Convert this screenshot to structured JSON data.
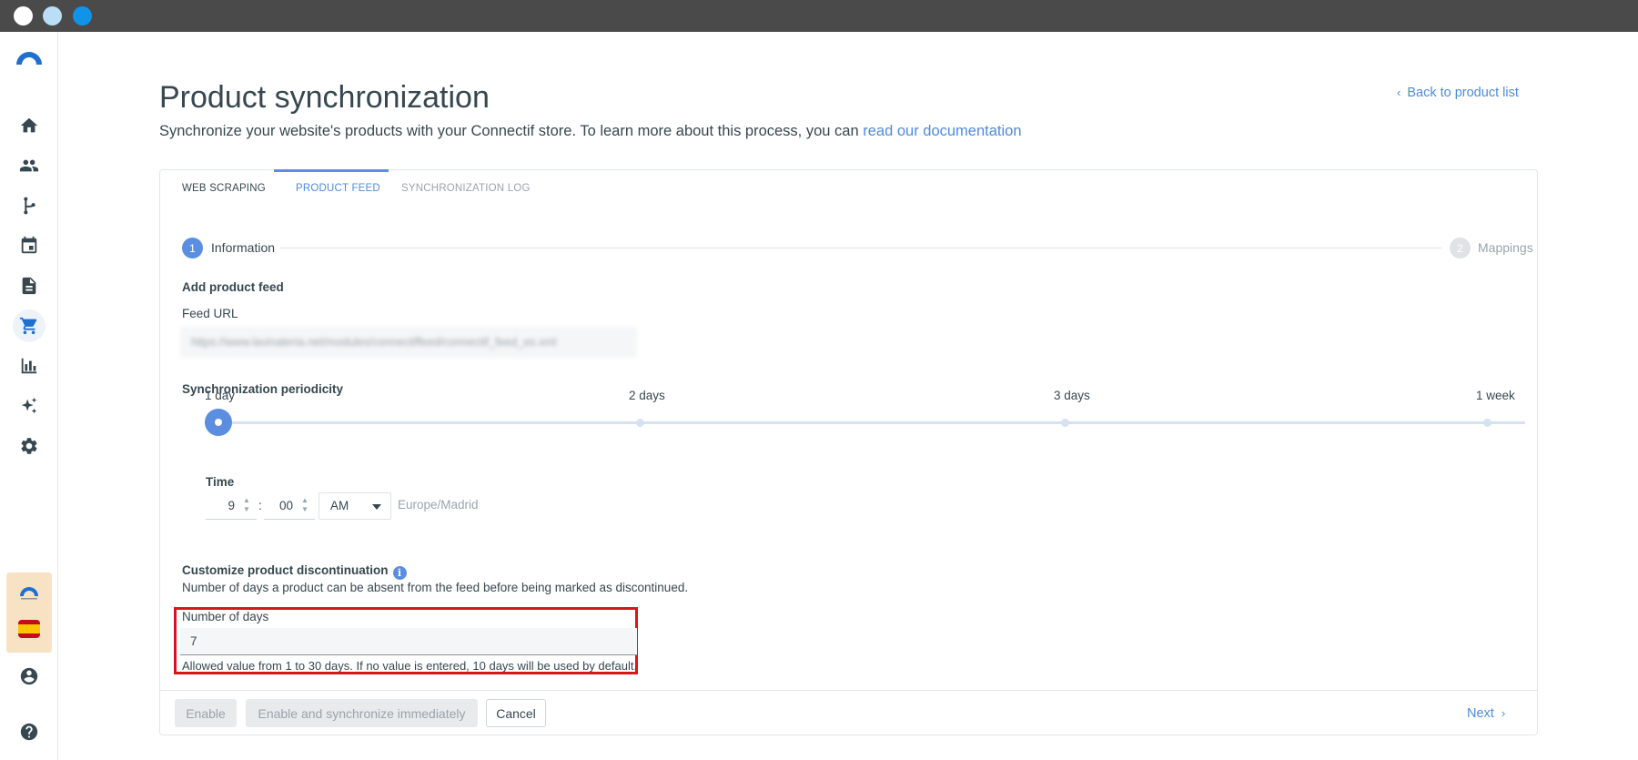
{
  "window": {
    "controls": [
      "close",
      "minimize",
      "maximize"
    ]
  },
  "sidebar": {
    "items": [
      {
        "icon": "home-icon"
      },
      {
        "icon": "contacts-icon"
      },
      {
        "icon": "workflow-icon"
      },
      {
        "icon": "calendar-icon"
      },
      {
        "icon": "document-icon"
      },
      {
        "icon": "cart-icon",
        "active": true
      },
      {
        "icon": "chart-icon"
      },
      {
        "icon": "sparkle-icon"
      },
      {
        "icon": "gear-icon"
      },
      {
        "icon": "user-icon"
      },
      {
        "icon": "help-icon"
      }
    ]
  },
  "header": {
    "title": "Product synchronization",
    "subtitle": "Synchronize your website's products with your Connectif store. To learn more about this process, you can ",
    "subtitle_link": "read our documentation",
    "back_link": "Back to product list"
  },
  "tabs": [
    {
      "label": "WEB SCRAPING"
    },
    {
      "label": "PRODUCT FEED",
      "active": true
    },
    {
      "label": "SYNCHRONIZATION LOG"
    }
  ],
  "stepper": {
    "steps": [
      {
        "number": "1",
        "label": "Information",
        "active": true
      },
      {
        "number": "2",
        "label": "Mappings",
        "active": false
      }
    ]
  },
  "form": {
    "add_feed_title": "Add product feed",
    "feed_url_label": "Feed URL",
    "feed_url_value": "https://www.lavinateria.net/modules/connectiffeed/connectif_feed_es.xml",
    "periodicity_title": "Synchronization periodicity",
    "periodicity_options": [
      "1 day",
      "2 days",
      "3 days",
      "1 week"
    ],
    "periodicity_selected": "1 day",
    "time_label": "Time",
    "time_hour": "9",
    "time_minute": "00",
    "time_separator": ":",
    "time_ampm": "AM",
    "timezone": "Europe/Madrid",
    "discontinuation_title": "Customize product discontinuation",
    "discontinuation_desc": "Number of days a product can be absent from the feed before being marked as discontinued.",
    "days_label": "Number of days",
    "days_value": "7",
    "days_hint": "Allowed value from 1 to 30 days. If no value is entered, 10 days will be used by default."
  },
  "footer": {
    "enable": "Enable",
    "enable_sync": "Enable and synchronize immediately",
    "cancel": "Cancel",
    "next": "Next"
  },
  "colors": {
    "accent": "#5b8ee0",
    "link": "#4d8bdc",
    "highlight_border": "#d9151c"
  }
}
